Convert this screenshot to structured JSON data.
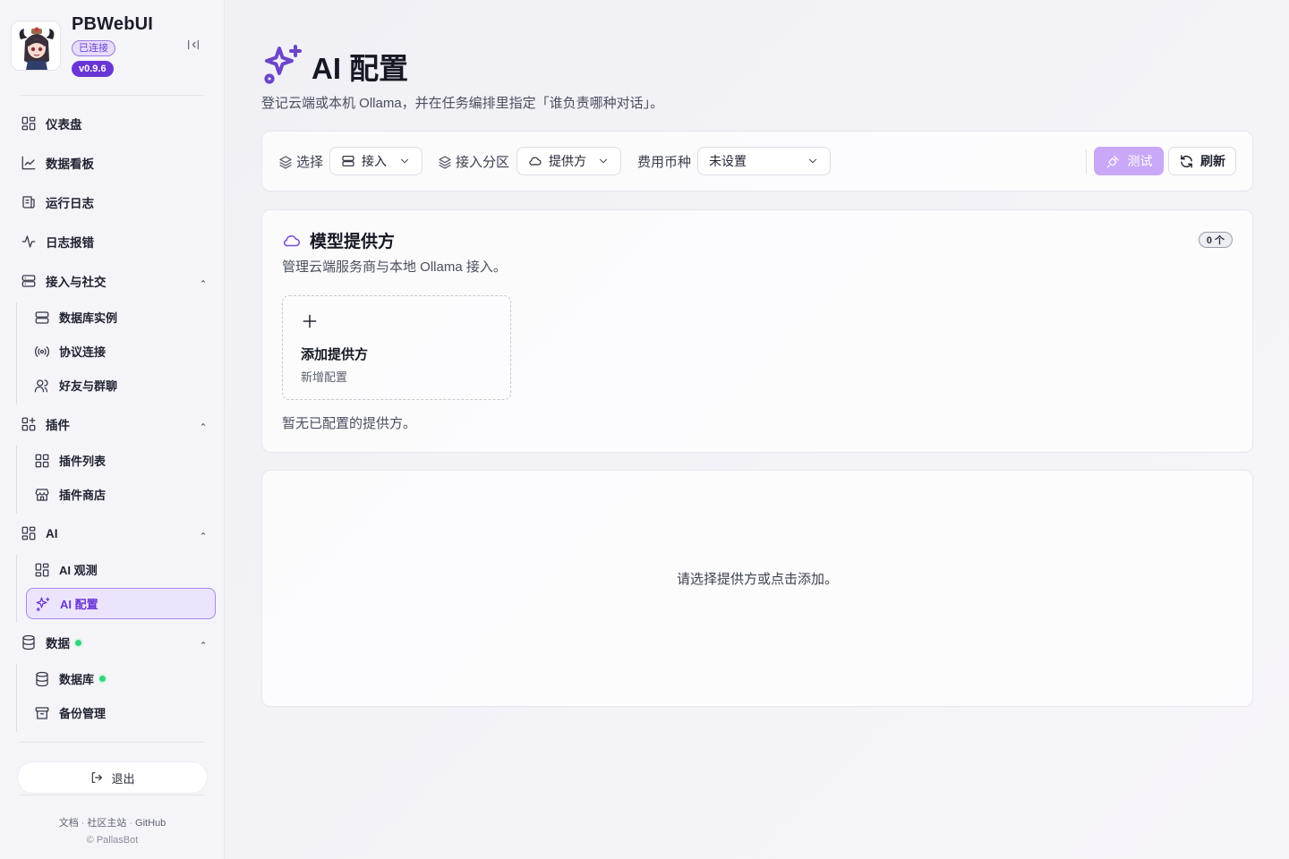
{
  "app": {
    "name": "PBWebUI",
    "status": "已连接",
    "version": "v0.9.6"
  },
  "sidebar": {
    "items": [
      {
        "label": "仪表盘",
        "icon": "dashboard-icon"
      },
      {
        "label": "数据看板",
        "icon": "line-chart-icon"
      },
      {
        "label": "运行日志",
        "icon": "log-icon"
      },
      {
        "label": "日志报错",
        "icon": "activity-icon"
      }
    ],
    "groups": [
      {
        "label": "接入与社交",
        "icon": "server-icon",
        "expanded": true,
        "children": [
          {
            "label": "数据库实例",
            "icon": "server-icon"
          },
          {
            "label": "协议连接",
            "icon": "broadcast-icon"
          },
          {
            "label": "好友与群聊",
            "icon": "users-icon"
          }
        ]
      },
      {
        "label": "插件",
        "icon": "plugin-icon",
        "expanded": true,
        "children": [
          {
            "label": "插件列表",
            "icon": "plugin-icon"
          },
          {
            "label": "插件商店",
            "icon": "store-icon"
          }
        ]
      },
      {
        "label": "AI",
        "icon": "dashboard-icon",
        "expanded": true,
        "children": [
          {
            "label": "AI 观测",
            "icon": "dashboard-icon"
          },
          {
            "label": "AI 配置",
            "icon": "sparkles-icon",
            "active": true
          }
        ]
      },
      {
        "label": "数据",
        "icon": "database-icon",
        "expanded": true,
        "status": "online",
        "children": [
          {
            "label": "数据库",
            "icon": "database-icon",
            "status": "online"
          },
          {
            "label": "备份管理",
            "icon": "archive-icon"
          }
        ]
      }
    ],
    "logout_label": "退出",
    "footer_links": [
      "文档",
      "社区主站",
      "GitHub"
    ],
    "copyright": "© PallasBot"
  },
  "page": {
    "title": "AI 配置",
    "subtitle": "登记云端或本机 Ollama，并在任务编排里指定「谁负责哪种对话」。"
  },
  "toolbar": {
    "select_label": "选择",
    "select_value": "接入",
    "section_label": "接入分区",
    "section_value": "提供方",
    "currency_label": "费用币种",
    "currency_value": "未设置",
    "test_label": "测试",
    "refresh_label": "刷新"
  },
  "providers": {
    "title": "模型提供方",
    "description": "管理云端服务商与本地 Ollama 接入。",
    "count": "0 个",
    "add_title": "添加提供方",
    "add_subtitle": "新增配置",
    "empty_text": "暂无已配置的提供方。"
  },
  "detail": {
    "placeholder": "请选择提供方或点击添加。"
  },
  "colors": {
    "accent": "#6a35d6",
    "accent_soft": "#ece4fc",
    "online": "#34d37f",
    "test_button": "#c8a8f7"
  }
}
